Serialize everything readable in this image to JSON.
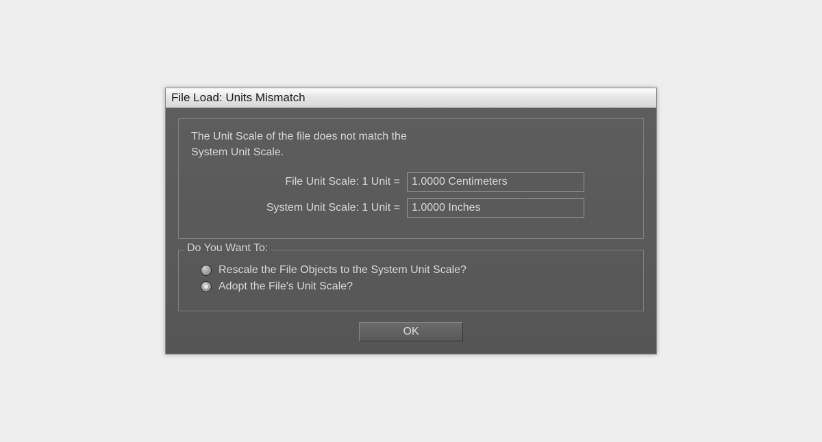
{
  "dialog": {
    "title": "File Load: Units Mismatch",
    "description_line1": "The Unit Scale of the file does not match the",
    "description_line2": "System Unit Scale.",
    "file_unit_label": "File Unit Scale: 1 Unit =",
    "file_unit_value": "1.0000 Centimeters",
    "system_unit_label": "System Unit Scale: 1 Unit =",
    "system_unit_value": "1.0000 Inches",
    "options_legend": "Do You Want To:",
    "option_rescale": "Rescale the File Objects to the System Unit Scale?",
    "option_adopt": "Adopt the File's Unit Scale?",
    "selected_option": "adopt",
    "ok_label": "OK"
  }
}
